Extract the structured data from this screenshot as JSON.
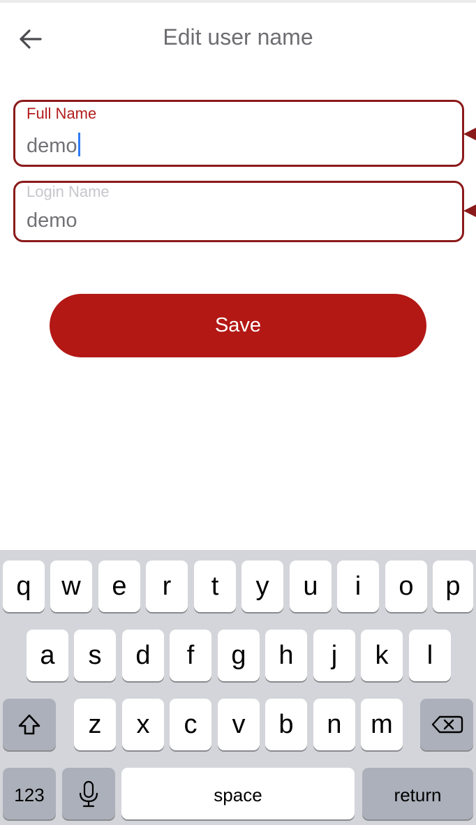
{
  "header": {
    "title": "Edit user name",
    "back_icon": "back-arrow-icon"
  },
  "form": {
    "full_name": {
      "label": "Full Name",
      "value": "demo"
    },
    "login_name": {
      "label": "Login Name",
      "value": "demo"
    }
  },
  "actions": {
    "save_label": "Save"
  },
  "colors": {
    "accent": "#b31815",
    "field_border": "#8b1a1a",
    "caret": "#2f7bf6",
    "keyboard_bg": "#d3d5da"
  },
  "keyboard": {
    "row1": [
      "q",
      "w",
      "e",
      "r",
      "t",
      "y",
      "u",
      "i",
      "o",
      "p"
    ],
    "row2": [
      "a",
      "s",
      "d",
      "f",
      "g",
      "h",
      "j",
      "k",
      "l"
    ],
    "row3": [
      "z",
      "x",
      "c",
      "v",
      "b",
      "n",
      "m"
    ],
    "shift_icon": "shift-icon",
    "backspace_icon": "backspace-icon",
    "numbers_label": "123",
    "mic_icon": "microphone-icon",
    "space_label": "space",
    "return_label": "return"
  }
}
